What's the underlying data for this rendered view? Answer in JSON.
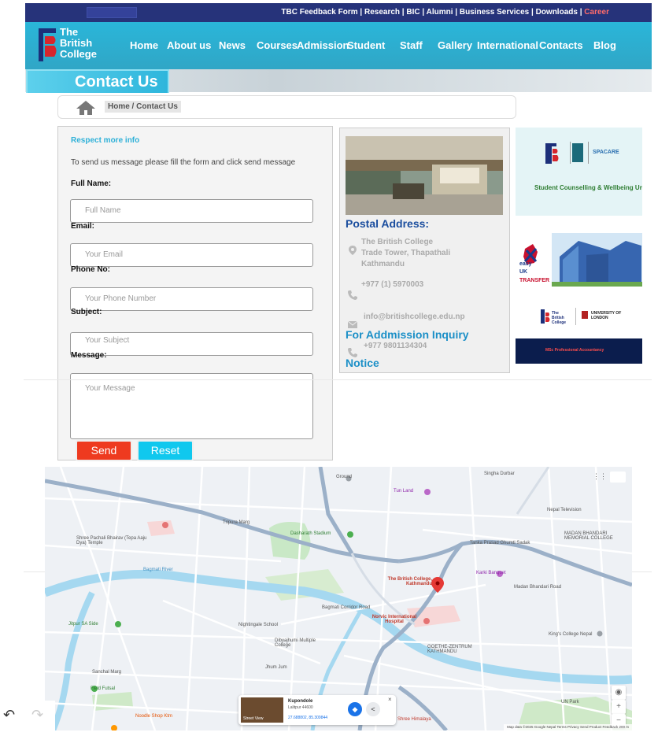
{
  "topbar": {
    "links": [
      "TBC Feedback Form",
      "Research",
      "BIC",
      "Alumni",
      "Business Services",
      "Downloads"
    ],
    "separator": " | ",
    "career": "Career"
  },
  "logo": {
    "line1": "The",
    "line2": "British",
    "line3": "College"
  },
  "nav": [
    "Home",
    "About us",
    "News",
    "Courses",
    "Admission",
    "Student",
    "Staff",
    "Gallery",
    "International",
    "Contacts",
    "Blog"
  ],
  "page_title": "Contact Us",
  "breadcrumb": "Home / Contact Us",
  "form": {
    "heading": "Respect more info",
    "description": "To send us message please fill the form and click send message",
    "fields": [
      {
        "label": "Full Name:",
        "placeholder": "Full Name"
      },
      {
        "label": "Email:",
        "placeholder": "Your Email"
      },
      {
        "label": "Phone No:",
        "placeholder": "Your Phone Number"
      },
      {
        "label": "Subject:",
        "placeholder": "Your Subject"
      }
    ],
    "message_label": "Message:",
    "message_placeholder": "Your Message",
    "send": "Send",
    "reset": "Reset"
  },
  "address": {
    "postal_heading": "Postal Address:",
    "postal_lines": [
      "The British College",
      "Trade Tower, Thapathali",
      "Kathmandu"
    ],
    "phone": "+977 (1) 5970003",
    "email": "info@britishcollege.edu.np",
    "admission_heading": "For Addmission Inquiry",
    "admission_phone": "+977 9801134304",
    "notice_heading": "Notice"
  },
  "banners": {
    "b1_text": "Student Counselling & Wellbeing Unit",
    "b1_tag": "SPACARE",
    "b2_text_1": "easy",
    "b2_text_2": "UK",
    "b2_text_3": "TRANSFER",
    "b3_logo_1": "The British College",
    "b3_logo_2": "UNIVERSITY OF LONDON",
    "b3_text": "MSc Professional Accountancy"
  },
  "map": {
    "labels": [
      "Singha Durbar",
      "Ground",
      "Tun Land",
      "Nepal Television",
      "MADAN BHANDARI MEMORIAL COLLEGE",
      "Dasharath Stadium",
      "Tripura Marg",
      "Shree Pachali Bhairav (Tepa Aaju Dya) Temple",
      "Bagmati River",
      "Tanka Prasad Ghumti Sadak",
      "Karki Banquet",
      "Madan Bhandari Road",
      "The British College, Kathmandu",
      "Norvic International Hospital",
      "Nightingale School",
      "Dibyajhumi Multiple College",
      "GOETHE-ZENTRUM KATHMANDU",
      "King's College Nepal",
      "Jitpur SA Side",
      "Field Futsal",
      "Sanchal Marg",
      "Jhum Jum",
      "Noodle Shop Ktm",
      "Shree Himalaya",
      "UN Park",
      "Bagmati Corridor Road"
    ],
    "card_name": "Kupondole",
    "card_address": "Lalitpur 44600",
    "card_coords": "27.688802, 85.309844",
    "card_street_view": "Street View",
    "attribution": "Map data ©2025 Google   Nepal   Terms   Privacy   Send Product Feedback   200 m"
  },
  "colors": {
    "header_cyan": "#2ea9c9",
    "topbar_navy": "#26337a",
    "send_red": "#ee3a1f",
    "reset_cyan": "#10c8ee",
    "heading_blue": "#1a4d9e"
  }
}
